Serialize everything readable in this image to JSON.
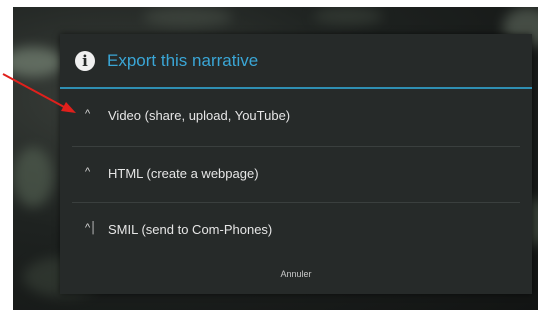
{
  "dialog": {
    "title": "Export this narrative",
    "info_icon_glyph": "i",
    "accent_color": "#2f8fb3",
    "options": [
      {
        "icon": "^",
        "label": "Video (share, upload, YouTube)"
      },
      {
        "icon": "^",
        "label": "HTML (create a webpage)"
      },
      {
        "icon": "^│",
        "label": "SMIL (send to Com-Phones)"
      }
    ],
    "cancel_label": "Annuler"
  },
  "annotation": {
    "color": "#e0201c",
    "icon": "red-arrow-icon"
  }
}
